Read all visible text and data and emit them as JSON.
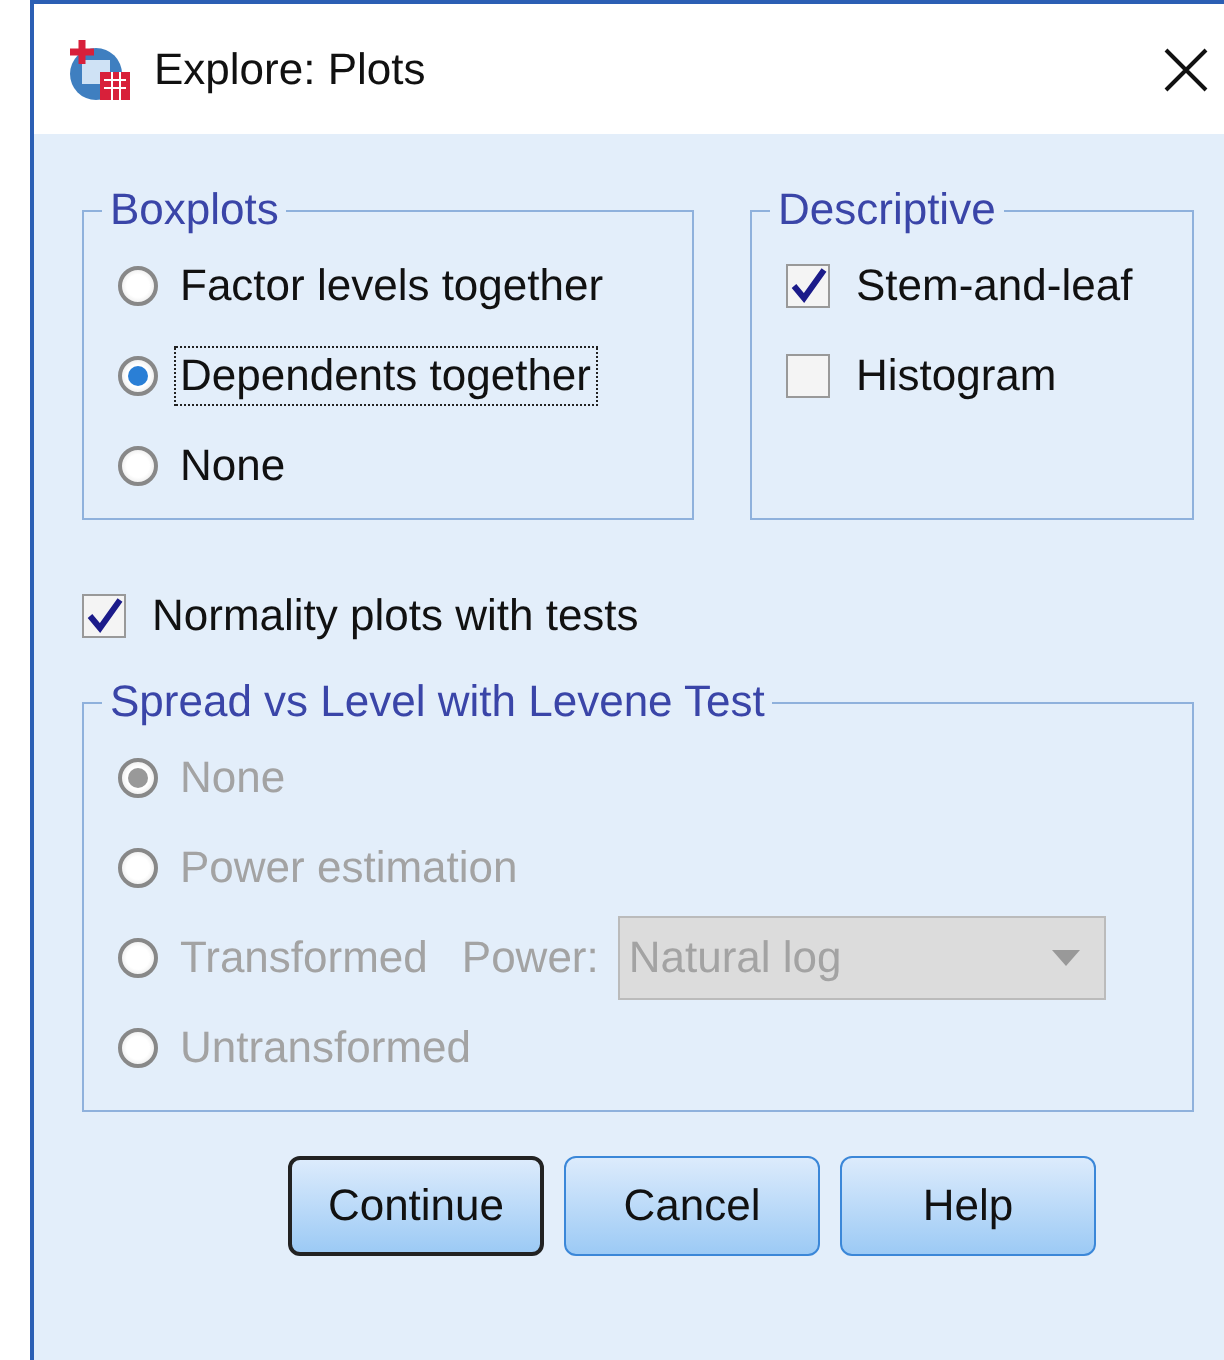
{
  "window": {
    "title": "Explore: Plots"
  },
  "boxplots": {
    "legend": "Boxplots",
    "options": [
      {
        "label": "Factor levels together",
        "selected": false,
        "focused": false
      },
      {
        "label": "Dependents together",
        "selected": true,
        "focused": true
      },
      {
        "label": "None",
        "selected": false,
        "focused": false
      }
    ]
  },
  "descriptive": {
    "legend": "Descriptive",
    "options": [
      {
        "label": "Stem-and-leaf",
        "checked": true
      },
      {
        "label": "Histogram",
        "checked": false
      }
    ]
  },
  "normality": {
    "label": "Normality plots with tests",
    "checked": true
  },
  "spread": {
    "legend": "Spread vs Level with Levene Test",
    "disabled": true,
    "options": [
      {
        "label": "None",
        "selected": true
      },
      {
        "label": "Power estimation",
        "selected": false
      },
      {
        "label": "Transformed",
        "selected": false,
        "power": {
          "label": "Power:",
          "value": "Natural log"
        }
      },
      {
        "label": "Untransformed",
        "selected": false
      }
    ]
  },
  "buttons": [
    {
      "label": "Continue",
      "default": true
    },
    {
      "label": "Cancel",
      "default": false
    },
    {
      "label": "Help",
      "default": false
    }
  ]
}
